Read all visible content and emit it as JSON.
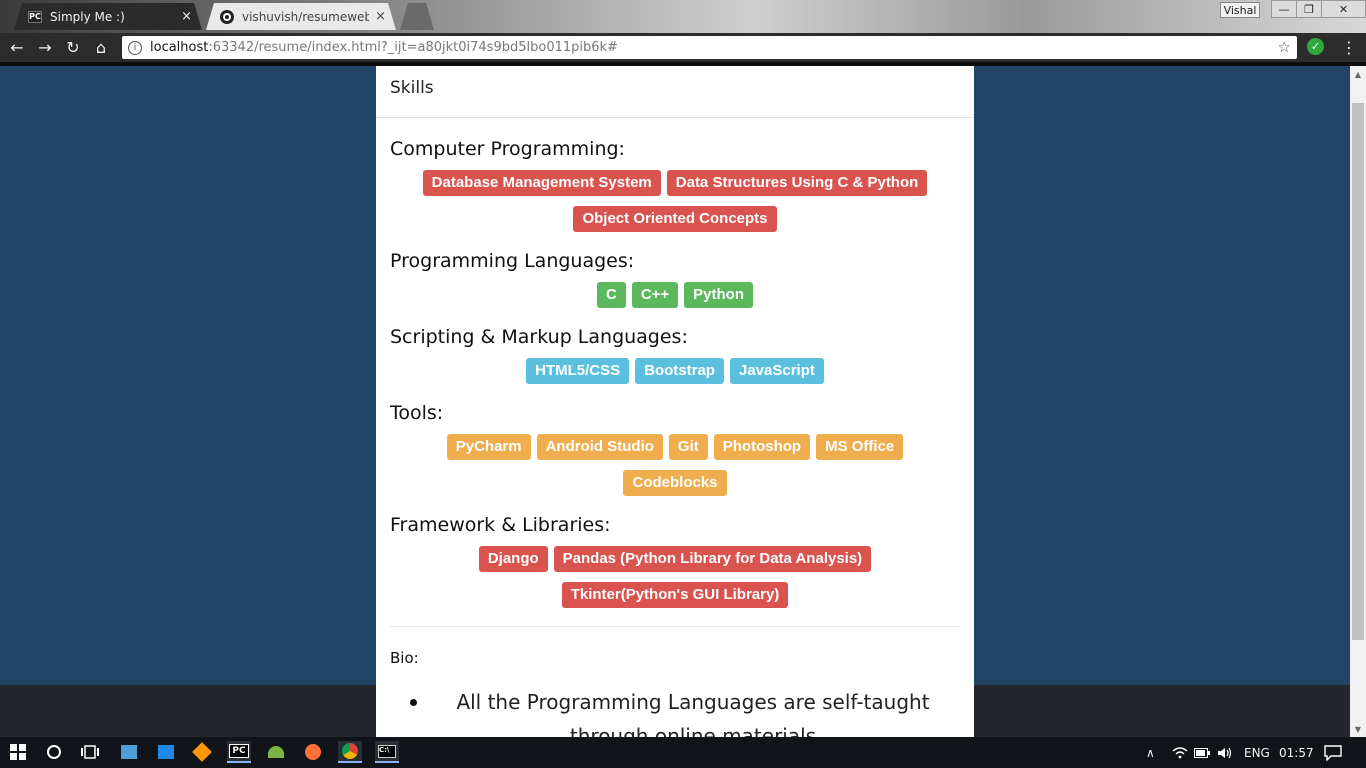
{
  "browser": {
    "tabs": [
      {
        "favicon": "PC",
        "title": "Simply Me :)",
        "close": "×"
      },
      {
        "favicon": "",
        "title": "vishuvish/resumewebsite",
        "close": "×"
      }
    ],
    "user": "Vishal",
    "window_controls": {
      "min": "—",
      "max": "❐",
      "close": "✕"
    },
    "nav": {
      "back": "←",
      "forward": "→",
      "reload": "↻",
      "home": "⌂"
    },
    "url_host": "localhost",
    "url_path": ":63342/resume/index.html?_ijt=a80jkt0i74s9bd5lbo011pib6k#",
    "star": "☆",
    "menu": "⋮"
  },
  "panel": {
    "heading": "Skills",
    "sections": [
      {
        "title": "Computer Programming:",
        "color": "#d9534f",
        "items": [
          "Database Management System",
          "Data Structures Using C & Python",
          "Object Oriented Concepts"
        ]
      },
      {
        "title": "Programming Languages:",
        "color": "#5cb85c",
        "items": [
          "C",
          "C++",
          "Python"
        ]
      },
      {
        "title": "Scripting & Markup Languages:",
        "color": "#5bc0de",
        "items": [
          "HTML5/CSS",
          "Bootstrap",
          "JavaScript"
        ]
      },
      {
        "title": "Tools:",
        "color": "#f0ad4e",
        "items": [
          "PyCharm",
          "Android Studio",
          "Git",
          "Photoshop",
          "MS Office",
          "Codeblocks"
        ]
      },
      {
        "title": "Framework & Libraries:",
        "color": "#d9534f",
        "items": [
          "Django",
          "Pandas (Python Library for Data Analysis)",
          "Tkinter(Python's GUI Library)"
        ]
      }
    ],
    "bio_label": "Bio:",
    "bio_items": [
      "All the Programming Languages are self-taught through online materials"
    ]
  },
  "taskbar": {
    "language": "ENG",
    "time": "01:57"
  },
  "colors": {
    "page_bg": "#1f4465",
    "footer": "#23272b"
  }
}
